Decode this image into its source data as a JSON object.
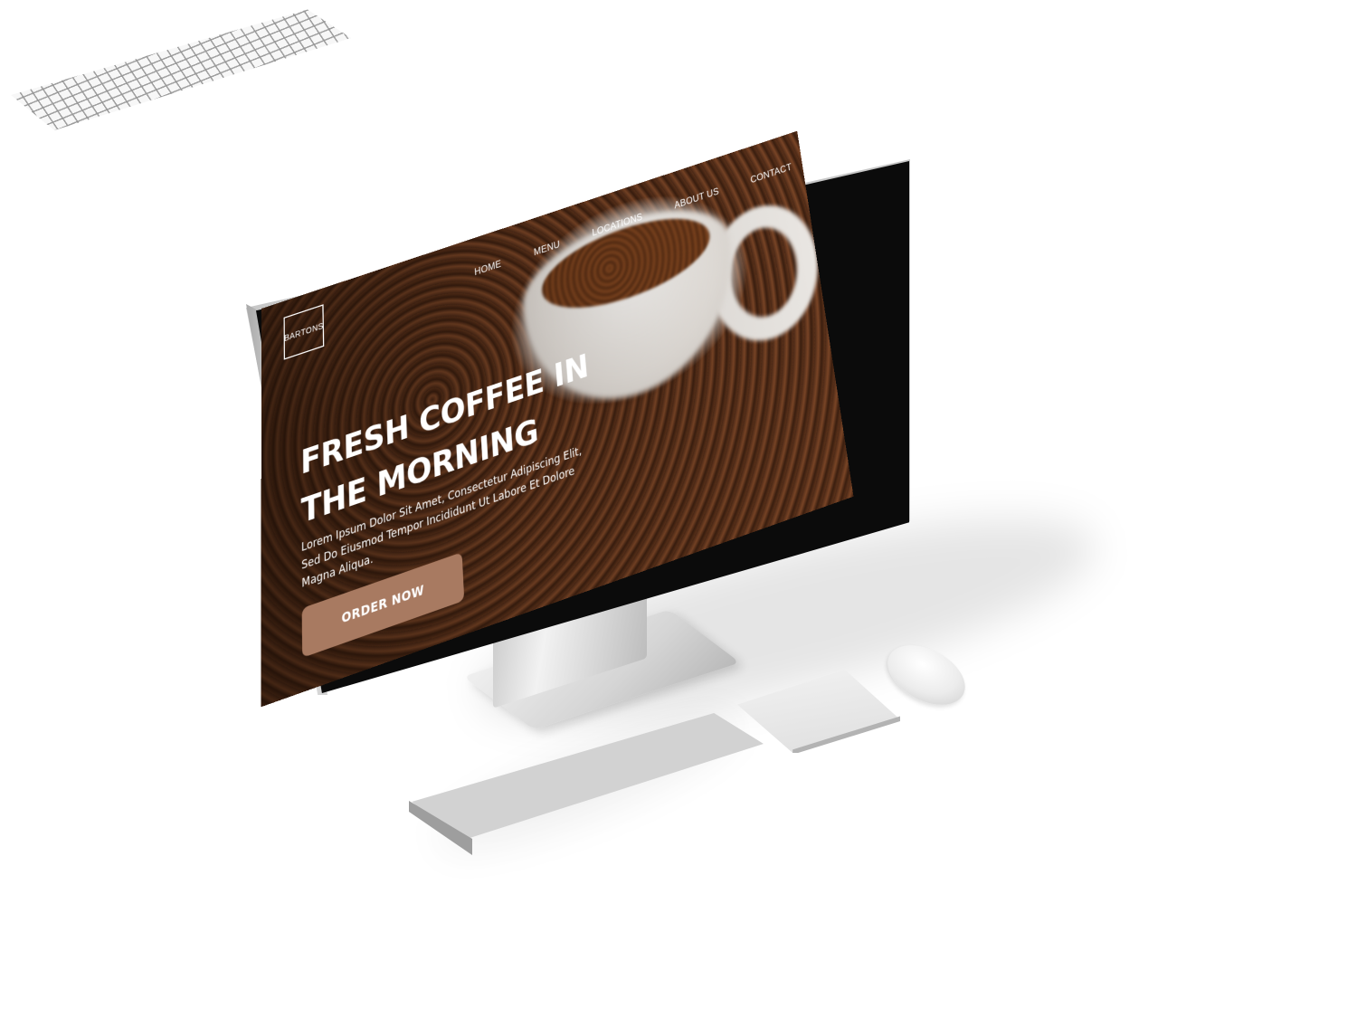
{
  "site": {
    "brand": "BARTONS",
    "nav": {
      "items": [
        "HOME",
        "MENU",
        "LOCATIONS",
        "ABOUT US",
        "CONTACT"
      ]
    },
    "hero": {
      "title_line1": "FRESH COFFEE IN",
      "title_line2": "THE MORNING",
      "body": "Lorem Ipsum Dolor Sit Amet, Consectetur Adipiscing Elit, Sed Do Eiusmod Tempor Incididunt Ut Labore Et Dolore Magna Aliqua.",
      "cta_label": "ORDER NOW"
    }
  },
  "colors": {
    "accent": "#a87a61",
    "text_on_dark": "#ffffff",
    "background": "#ffffff"
  },
  "icons": {
    "logo": "square-outline-logo"
  }
}
